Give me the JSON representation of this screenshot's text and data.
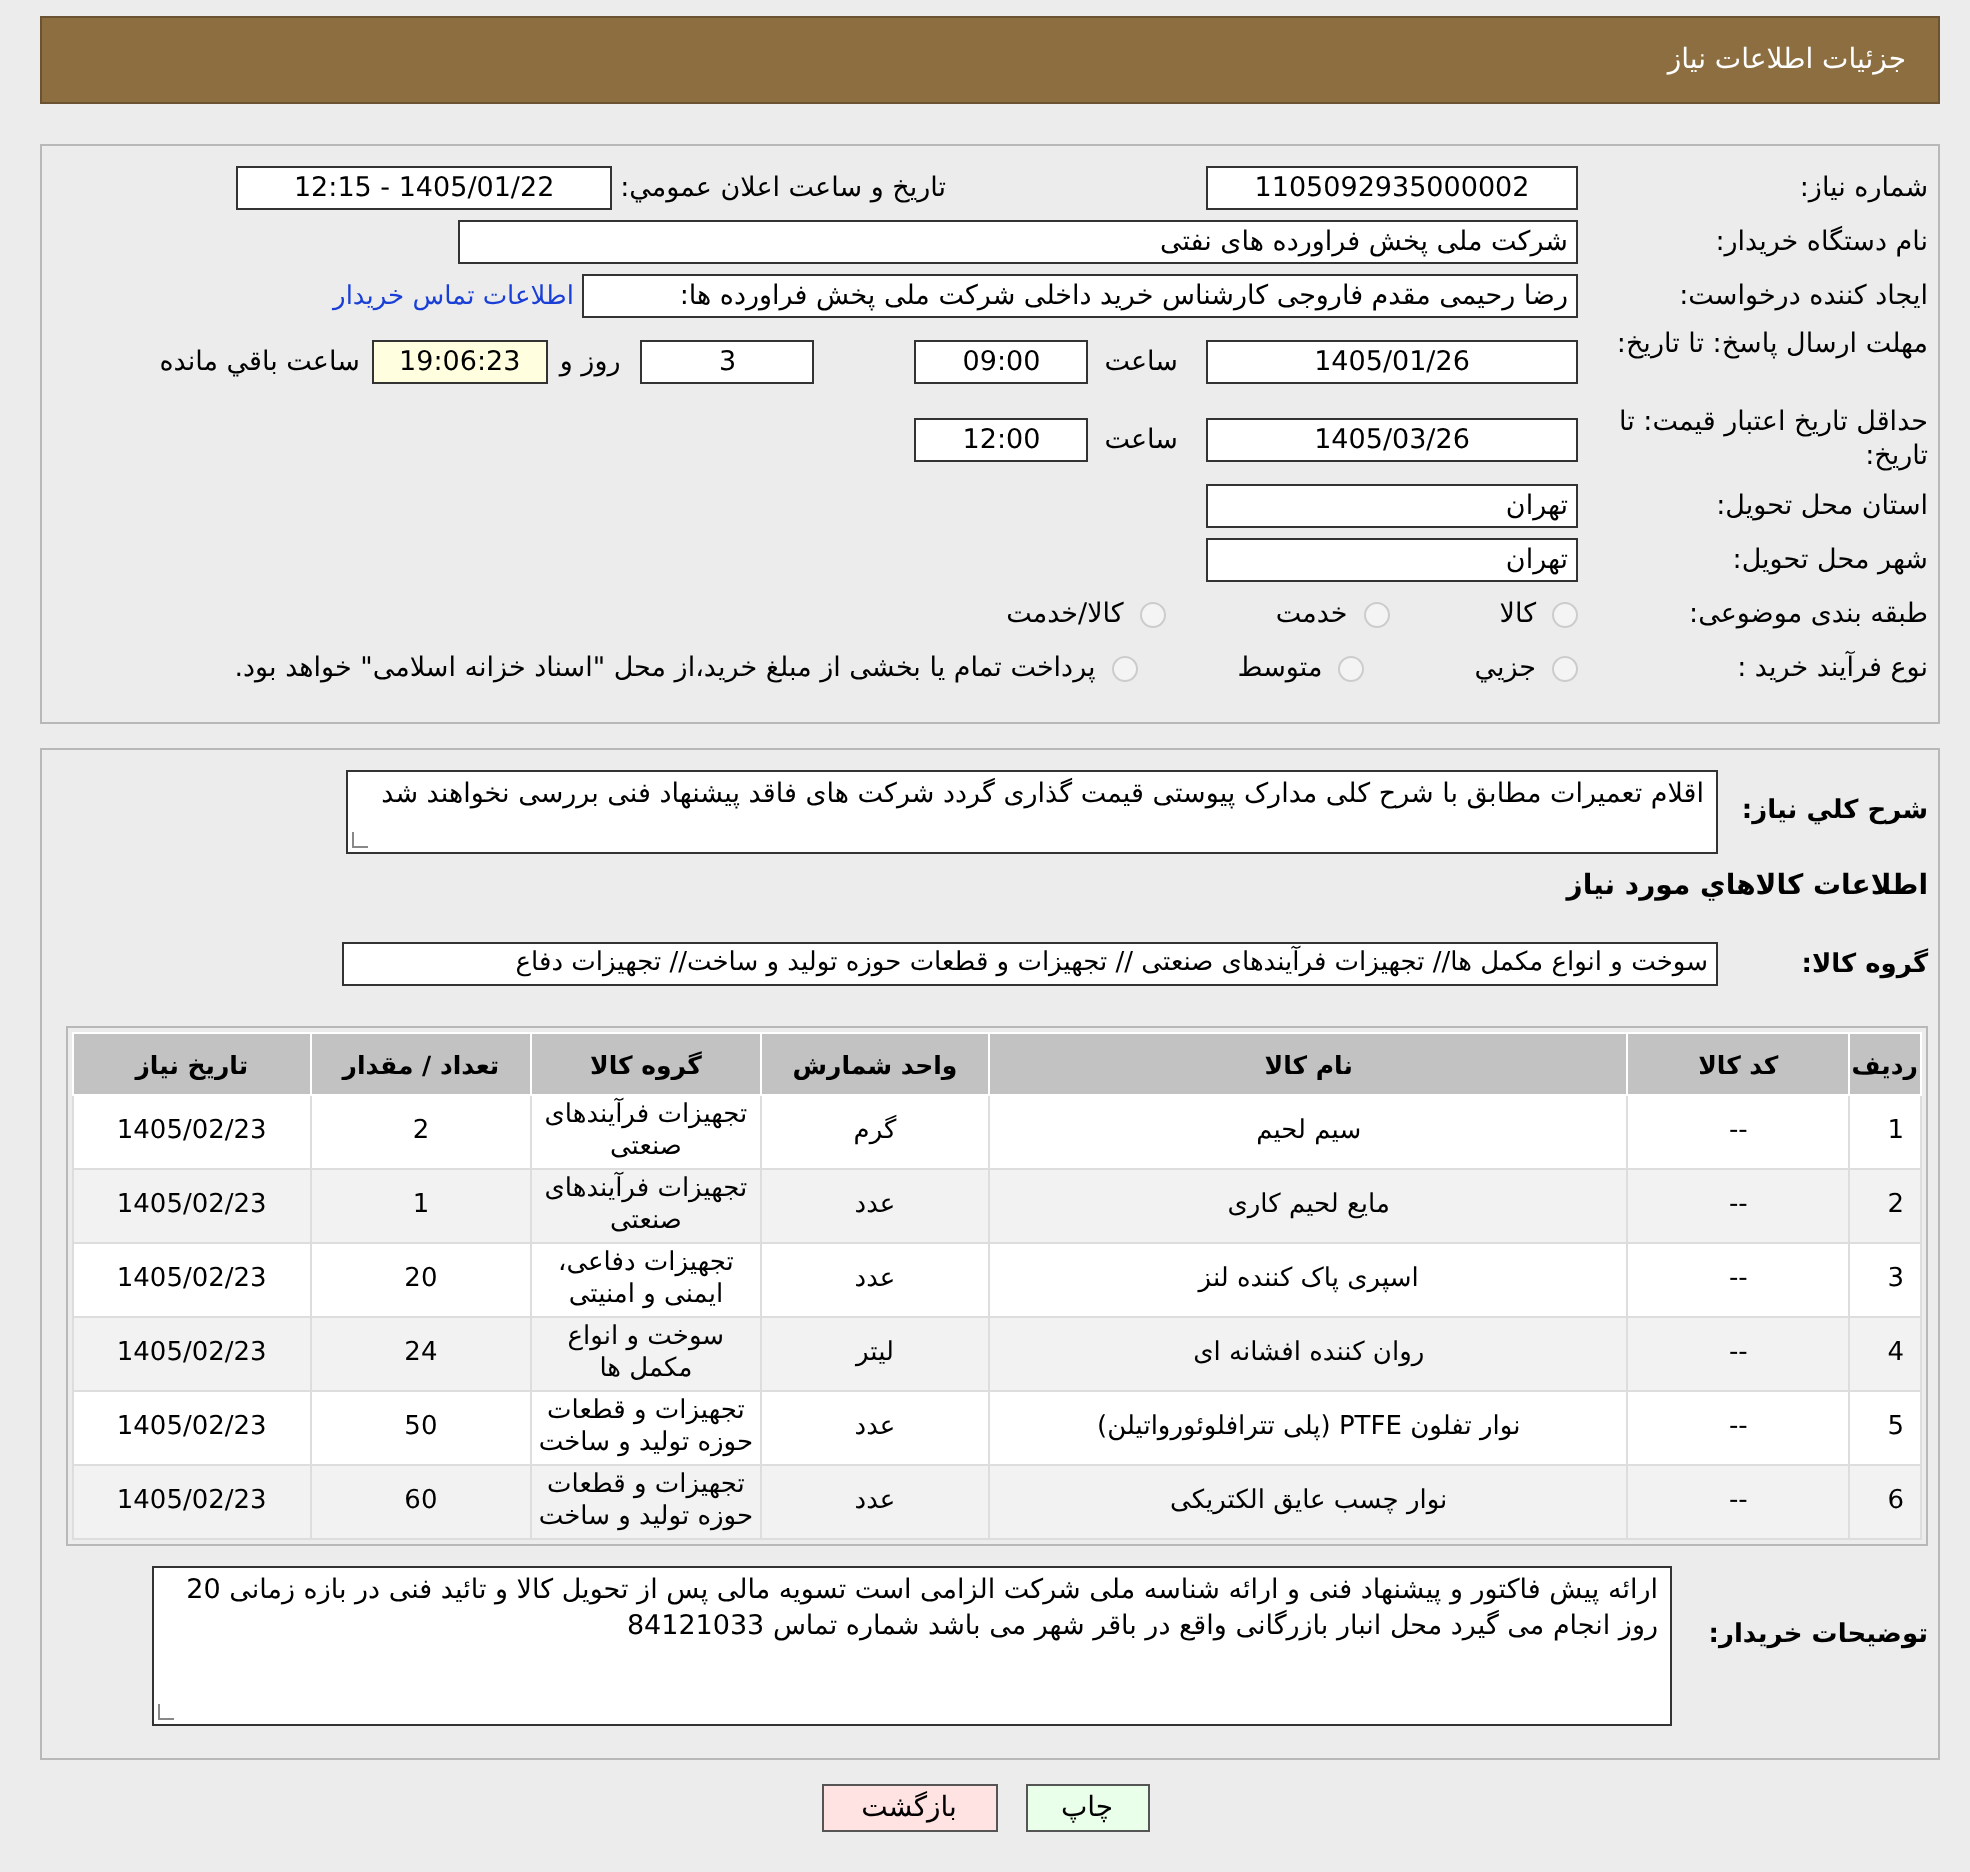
{
  "header": {
    "title": "جزئیات اطلاعات نیاز"
  },
  "details": {
    "need_number": {
      "label": "شماره نیاز:",
      "value": "1105092935000002"
    },
    "announce": {
      "label": "تاریخ و ساعت اعلان عمومي:",
      "value": "1405/01/22 - 12:15"
    },
    "buyer": {
      "label": "نام دستگاه خریدار:",
      "value": "شرکت ملی پخش فراورده های نفتی"
    },
    "requester": {
      "label": "ایجاد کننده درخواست:",
      "value": "رضا رحیمی مقدم فاروجی  کارشناس خرید داخلی شرکت ملی پخش فراورده ها:",
      "link": "اطلاعات تماس خریدار"
    },
    "deadline": {
      "label": "مهلت ارسال پاسخ: تا تاریخ:",
      "date": "1405/01/26",
      "time_label": "ساعت",
      "time": "09:00",
      "days": "3",
      "days_label": "روز و",
      "remaining": "19:06:23",
      "remaining_label": "ساعت باقي مانده"
    },
    "validity": {
      "label": "حداقل تاریخ اعتبار قیمت: تا تاریخ:",
      "date": "1405/03/26",
      "time_label": "ساعت",
      "time": "12:00"
    },
    "province": {
      "label": "استان محل تحویل:",
      "value": "تهران"
    },
    "city": {
      "label": "شهر محل تحویل:",
      "value": "تهران"
    },
    "category": {
      "label": "طبقه بندی موضوعی:",
      "options": [
        {
          "label": "كالا",
          "selected": false
        },
        {
          "label": "خدمت",
          "selected": false
        },
        {
          "label": "كالا/خدمت",
          "selected": false
        }
      ]
    },
    "process": {
      "label": "نوع فرآیند خرید :",
      "options": [
        {
          "label": "جزيي",
          "selected": false
        },
        {
          "label": "متوسط",
          "selected": false
        },
        {
          "label": "پرداخت تمام یا بخشی از مبلغ خرید،از محل \"اسناد خزانه اسلامی\" خواهد بود.",
          "selected": false
        }
      ]
    }
  },
  "summary": {
    "label": "شرح کلي نیاز:",
    "value": "اقلام تعمیرات مطابق با شرح کلی مدارک پیوستی قیمت گذاری گردد شرکت های فاقد پیشنهاد فنی بررسی نخواهند شد"
  },
  "goods_heading": "اطلاعات كالاهاي مورد نیاز",
  "goods_group": {
    "label": "گروه کالا:",
    "value": "سوخت و انواع مکمل ها// تجهیزات فرآیندهای صنعتی // تجهیزات و قطعات حوزه تولید و ساخت// تجهیزات دفاع"
  },
  "table": {
    "columns": [
      "ردیف",
      "کد کالا",
      "نام کالا",
      "واحد شمارش",
      "گروه کالا",
      "تعداد / مقدار",
      "تاریخ نیاز"
    ],
    "rows": [
      [
        "1",
        "--",
        "سیم لحیم",
        "گرم",
        "تجهیزات فرآیندهای صنعتی",
        "2",
        "1405/02/23"
      ],
      [
        "2",
        "--",
        "مایع لحیم کاری",
        "عدد",
        "تجهیزات فرآیندهای صنعتی",
        "1",
        "1405/02/23"
      ],
      [
        "3",
        "--",
        "اسپری پاک کننده لنز",
        "عدد",
        "تجهیزات دفاعی، ایمنی و امنیتی",
        "20",
        "1405/02/23"
      ],
      [
        "4",
        "--",
        "روان کننده افشانه ای",
        "لیتر",
        "سوخت و انواع مکمل ها",
        "24",
        "1405/02/23"
      ],
      [
        "5",
        "--",
        "نوار تفلون PTFE (پلی تترافلوئورواتیلن)",
        "عدد",
        "تجهیزات و قطعات حوزه تولید و ساخت",
        "50",
        "1405/02/23"
      ],
      [
        "6",
        "--",
        "نوار چسب عایق الکتریکی",
        "عدد",
        "تجهیزات و قطعات حوزه تولید و ساخت",
        "60",
        "1405/02/23"
      ]
    ]
  },
  "notes": {
    "label": "توضیحات خریدار:",
    "value": "ارائه پیش فاکتور و پیشنهاد فنی و ارائه شناسه ملی شرکت الزامی است تسویه مالی پس از تحویل کالا و تائید فنی در بازه زمانی 20 روز انجام می گیرد محل انبار بازرگانی واقع در باقر شهر می باشد شماره تماس 84121033"
  },
  "buttons": [
    {
      "label": "چاپ",
      "kind": "print"
    },
    {
      "label": "بازگشت",
      "kind": "back"
    }
  ]
}
